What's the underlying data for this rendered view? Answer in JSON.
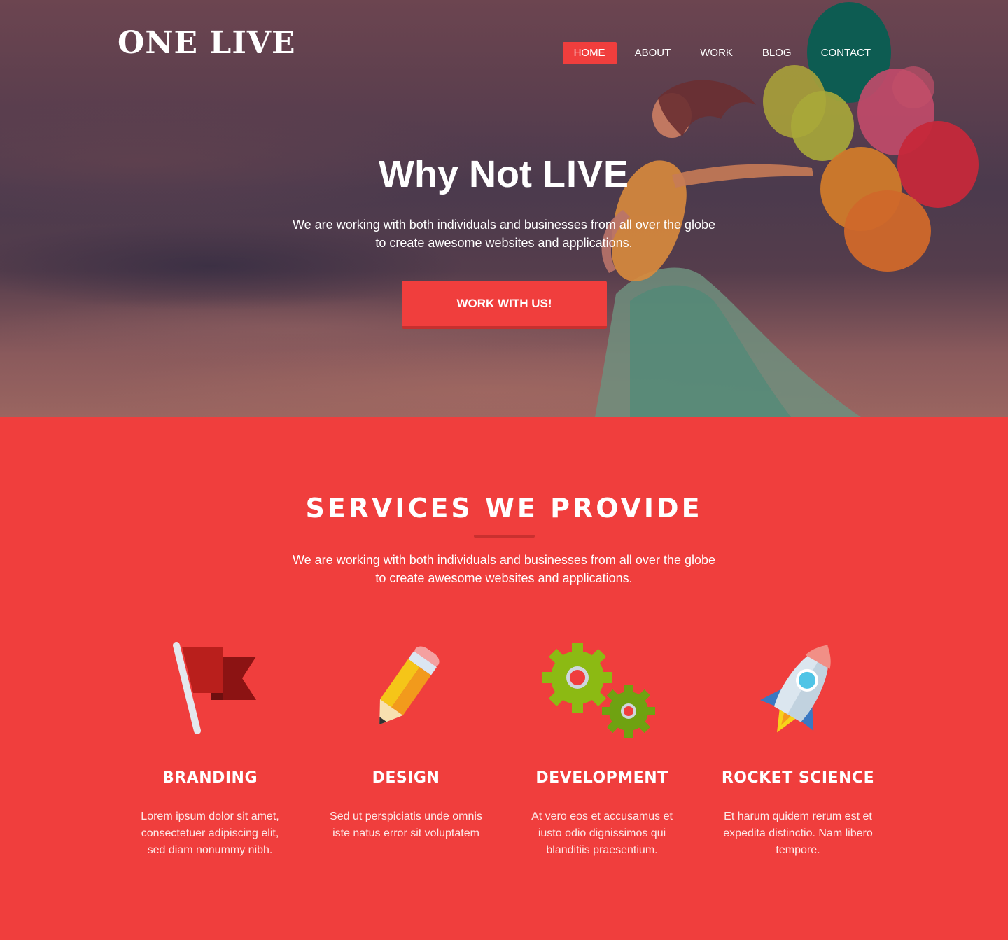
{
  "brand": {
    "logo": "ONE LIVE",
    "accent": "#f03e3d",
    "accent_dark": "#c6302f"
  },
  "nav": {
    "items": [
      {
        "label": "HOME",
        "active": true
      },
      {
        "label": "ABOUT",
        "active": false
      },
      {
        "label": "WORK",
        "active": false
      },
      {
        "label": "BLOG",
        "active": false
      },
      {
        "label": "CONTACT",
        "active": false
      }
    ]
  },
  "hero": {
    "title_light": "Why Not",
    "title_bold": "LIVE",
    "text_line1": "We are working with both individuals and businesses from all over the globe",
    "text_line2": "to create awesome websites and applications.",
    "cta": "WORK WITH US!"
  },
  "services": {
    "title": "SERVICES WE PROVIDE",
    "text_line1": "We are working with both individuals and businesses from all over the globe",
    "text_line2": "to create awesome websites and applications.",
    "items": [
      {
        "icon": "flag-icon",
        "title": "BRANDING",
        "text": "Lorem ipsum dolor sit amet, consectetuer adipiscing elit, sed diam nonummy nibh."
      },
      {
        "icon": "pencil-icon",
        "title": "DESIGN",
        "text": "Sed ut perspiciatis unde omnis iste natus error sit voluptatem"
      },
      {
        "icon": "gears-icon",
        "title": "DEVELOPMENT",
        "text": "At vero eos et accusamus et iusto odio dignissimos qui blanditiis praesentium."
      },
      {
        "icon": "rocket-icon",
        "title": "ROCKET SCIENCE",
        "text": "Et harum quidem rerum est et expedita distinctio. Nam libero tempore."
      }
    ]
  }
}
